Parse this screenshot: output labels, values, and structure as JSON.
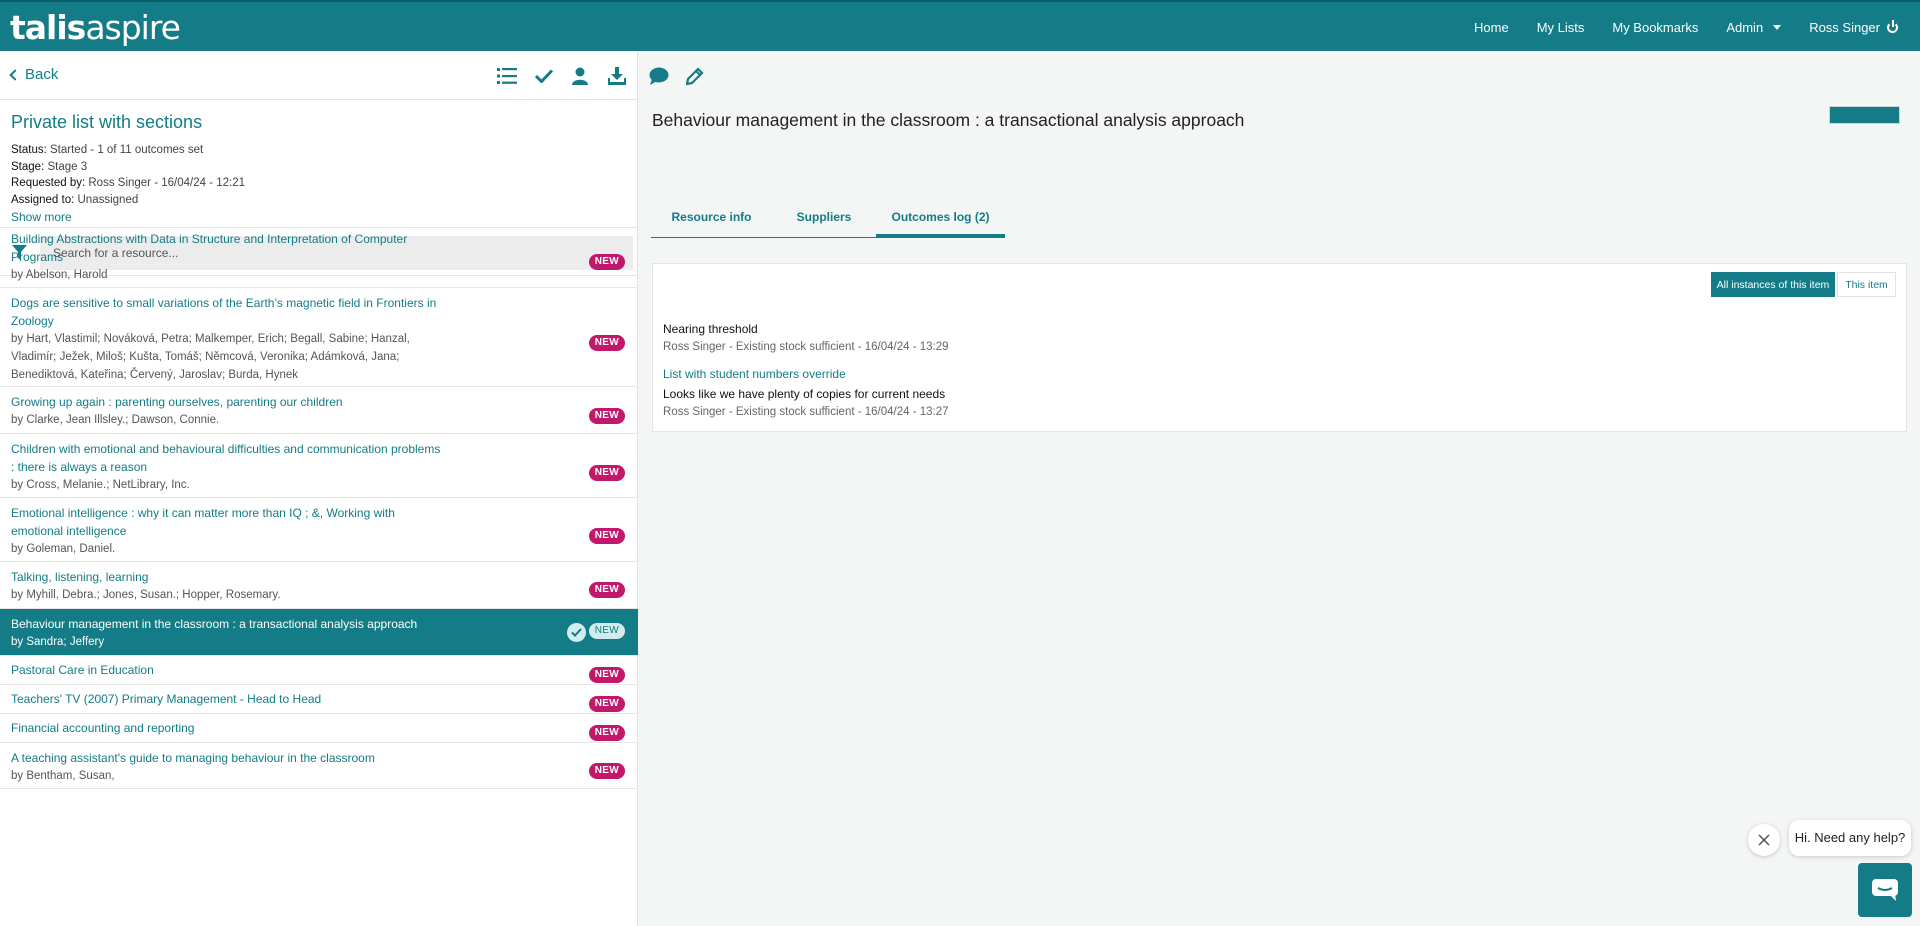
{
  "brand": {
    "logo_bold": "talis",
    "logo_light": "aspire"
  },
  "nav": {
    "home": "Home",
    "my_lists": "My Lists",
    "my_bookmarks": "My Bookmarks",
    "admin": "Admin",
    "user": "Ross Singer"
  },
  "toolbar": {
    "back": "Back"
  },
  "list": {
    "title": "Private list with sections",
    "status_label": "Status:",
    "status": "Started - 1 of 11 outcomes set",
    "stage_label": "Stage:",
    "stage": "Stage 3",
    "requested_label": "Requested by:",
    "requested": "Ross Singer - 16/04/24 - 12:21",
    "assigned_label": "Assigned to:",
    "assigned": "Unassigned",
    "show_more": "Show more"
  },
  "search": {
    "placeholder": "Search for a resource..."
  },
  "items": [
    {
      "title": "Building Abstractions with Data in Structure and Interpretation of Computer Programs",
      "authors": "by Abelson, Harold",
      "badge": "NEW"
    },
    {
      "title": "Dogs are sensitive to small variations of the Earth’s magnetic field in Frontiers in Zoology",
      "authors": "by Hart, Vlastimil; Nováková, Petra; Malkemper, Erich; Begall, Sabine; Hanzal, Vladimír; Ježek, Miloš; Kušta, Tomáš; Němcová, Veronika; Adámková, Jana; Benediktová, Kateřina; Červený, Jaroslav; Burda, Hynek",
      "badge": "NEW"
    },
    {
      "title": "Growing up again : parenting ourselves, parenting our children",
      "authors": "by Clarke, Jean Illsley.; Dawson, Connie.",
      "badge": "NEW"
    },
    {
      "title": "Children with emotional and behavioural difficulties and communication problems : there is always a reason",
      "authors": "by Cross, Melanie.; NetLibrary, Inc.",
      "badge": "NEW"
    },
    {
      "title": "Emotional intelligence : why it can matter more than IQ ; &, Working with emotional intelligence",
      "authors": "by Goleman, Daniel.",
      "badge": "NEW"
    },
    {
      "title": "Talking, listening, learning",
      "authors": "by Myhill, Debra.; Jones, Susan.; Hopper, Rosemary.",
      "badge": "NEW"
    },
    {
      "title": "Behaviour management in the classroom : a transactional analysis approach",
      "authors": "by Sandra; Jeffery",
      "badge": "NEW"
    },
    {
      "title": "Pastoral Care in Education",
      "authors": "",
      "badge": "NEW"
    },
    {
      "title": "Teachers' TV (2007) Primary Management - Head to Head",
      "authors": "",
      "badge": "NEW"
    },
    {
      "title": "Financial accounting and reporting",
      "authors": "",
      "badge": "NEW"
    },
    {
      "title": "A teaching assistant's guide to managing behaviour in the classroom",
      "authors": "by Bentham, Susan,",
      "badge": "NEW"
    }
  ],
  "detail": {
    "title": "Behaviour management in the classroom : a transactional analysis approach",
    "tabs": [
      "Resource info",
      "Suppliers",
      "Outcomes log (2)"
    ],
    "btn_all": "All instances of this item",
    "btn_this": "This item",
    "log": [
      {
        "heading": "Nearing threshold",
        "sub": "Ross Singer - Existing stock sufficient - 16/04/24 - 13:29"
      },
      {
        "link": "List with student numbers override",
        "heading": "Looks like we have plenty of copies for current needs",
        "sub": "Ross Singer - Existing stock sufficient - 16/04/24 - 13:27"
      }
    ]
  },
  "help": {
    "text": "Hi. Need any help?"
  },
  "colors": {
    "brand": "#137c86",
    "badge": "#c2186b"
  }
}
